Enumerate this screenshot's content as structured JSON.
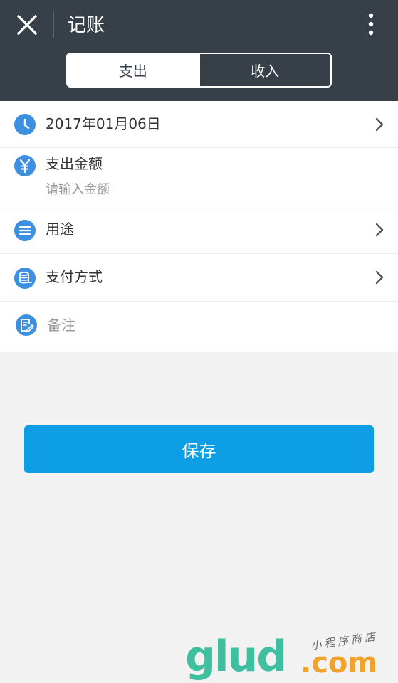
{
  "header": {
    "title": "记账",
    "close_icon": "close-icon",
    "more_icon": "more-vertical-icon"
  },
  "segment": {
    "tabs": [
      {
        "label": "支出",
        "active": true
      },
      {
        "label": "收入",
        "active": false
      }
    ]
  },
  "form": {
    "date": {
      "value": "2017年01月06日",
      "icon": "clock-icon"
    },
    "amount": {
      "label": "支出金额",
      "placeholder": "请输入金额",
      "icon": "yen-icon"
    },
    "purpose": {
      "label": "用途",
      "icon": "list-icon"
    },
    "payment": {
      "label": "支付方式",
      "icon": "database-icon"
    },
    "note": {
      "placeholder": "备注",
      "icon": "note-edit-icon"
    }
  },
  "actions": {
    "save_label": "保存"
  },
  "watermark": {
    "logo": "glud",
    "domain": ".com",
    "tagline": "小程序商店"
  },
  "colors": {
    "header_bg": "#373f48",
    "accent_blue": "#0e9ee6",
    "icon_blue": "#3d8fe0",
    "page_bg": "#f2f2f2"
  }
}
